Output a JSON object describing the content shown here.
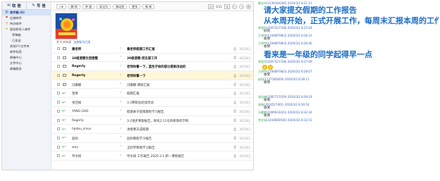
{
  "sidebar": {
    "receive_label": "收 信",
    "compose_label": "写 信",
    "items": [
      {
        "label": "收件箱 (6)",
        "icon": "inbox-icon",
        "active": true,
        "sub": false
      },
      {
        "label": "红旗邮件",
        "icon": "flag-icon",
        "active": false,
        "sub": false
      },
      {
        "label": "待办邮件",
        "icon": "clock-icon",
        "active": false,
        "sub": false
      },
      {
        "label": "星标联系人邮件",
        "icon": "star-icon",
        "active": false,
        "sub": false
      },
      {
        "label": "草稿箱",
        "icon": "",
        "active": false,
        "sub": true
      },
      {
        "label": "已发送",
        "icon": "",
        "active": false,
        "sub": true
      },
      {
        "label": "其他2个文件夹",
        "icon": "",
        "active": false,
        "sub": false
      },
      {
        "label": "邮件标签",
        "icon": "",
        "active": false,
        "sub": false
      },
      {
        "label": "邮箱中心",
        "icon": "",
        "active": false,
        "sub": false
      },
      {
        "label": "文件中心",
        "icon": "",
        "active": false,
        "sub": false
      },
      {
        "label": "邮箱服务",
        "icon": "",
        "active": false,
        "sub": false
      }
    ]
  },
  "toolbar": {
    "buttons": [
      "删 除",
      "举 报",
      "标记为",
      "移动到",
      "更多",
      "刷 新"
    ],
    "page": "1/11"
  },
  "summary": {
    "count": "共 4 封未读",
    "mark_all": "全部标为已读"
  },
  "emails": [
    {
      "from": "秦老师",
      "subject": "秦老师假期工作汇报",
      "time": "3月10日",
      "unread": true,
      "replied": false,
      "attach": true,
      "selected": false
    },
    {
      "from": "20级酒管生团委整",
      "subject": "20级酒管-团支部工作",
      "time": "3月10日",
      "unread": true,
      "replied": false,
      "attach": true,
      "selected": false
    },
    {
      "from": "Rogerly",
      "subject": "老师你看一下，蓝色字体的部分是新改动的",
      "time": "3月10日",
      "unread": true,
      "replied": false,
      "attach": true,
      "selected": false
    },
    {
      "from": "Rogerly",
      "subject": "老师你看一下",
      "time": "3月10日",
      "unread": true,
      "replied": false,
      "attach": true,
      "selected": true
    },
    {
      "from": "冯娜娜",
      "subject": "冯娜娜-寒假汇报",
      "time": "3月10日",
      "unread": false,
      "replied": false,
      "attach": true,
      "selected": false
    },
    {
      "from": "邹青",
      "subject": "假期汇报",
      "time": "3月10日",
      "unread": false,
      "replied": true,
      "attach": true,
      "selected": false
    },
    {
      "from": "张佳楠",
      "subject": "3.2寒假总结加活动",
      "time": "3月10日",
      "unread": false,
      "replied": true,
      "attach": true,
      "selected": false
    },
    {
      "from": "YANG GAO",
      "subject": "假期关于疫情期的学习报告",
      "time": "3月10日",
      "unread": false,
      "replied": true,
      "attach": true,
      "selected": false
    },
    {
      "from": "Rogerly",
      "subject": "3-2逐步寒假报告，附有2.11号的修改的学和",
      "time": "3月10日",
      "unread": false,
      "replied": true,
      "attach": true,
      "selected": false
    },
    {
      "from": "hpdou_sinus",
      "subject": "承接寒天成假期",
      "time": "3月10日",
      "unread": false,
      "replied": true,
      "attach": true,
      "selected": false
    },
    {
      "from": "赵阳",
      "subject": "赵阳寒假学习报告",
      "time": "3月10日",
      "unread": false,
      "replied": true,
      "attach": true,
      "selected": false
    },
    {
      "from": "wxy",
      "subject": "王欣宇寒假学习报告",
      "time": "3月10日",
      "unread": false,
      "replied": true,
      "attach": true,
      "selected": false
    },
    {
      "from": "夸文如",
      "subject": "夸文如 工作报告 2020.3.1.新---寒假报告",
      "time": "3月10日",
      "unread": false,
      "replied": true,
      "attach": true,
      "selected": false
    }
  ],
  "chat": [
    {
      "type": "msg",
      "name": "曾文玲",
      "id": "(3136184180)",
      "date": "2020/3/2 8:21:12"
    },
    {
      "type": "big",
      "text": "请大家提交假期的工作报告"
    },
    {
      "type": "big",
      "text": "从本周开始，正式开展工作，每周末汇报本周的工作"
    },
    {
      "type": "msg",
      "name": "李国华",
      "id": "(2007321748)",
      "date": "2020/3/2 8:25:44"
    },
    {
      "type": "text",
      "text": "好的"
    },
    {
      "type": "msg",
      "name": "王明宇",
      "id": "(1194897863)",
      "date": "2020/3/2 8:26:10"
    },
    {
      "type": "text",
      "text": "收到"
    },
    {
      "type": "msg",
      "name": "王明宇",
      "id": "(1194897863)",
      "date": "2020/3/2 8:26:40"
    },
    {
      "type": "text",
      "text": "收到"
    },
    {
      "type": "big",
      "text": "看来是一年级的同学起得早一点"
    },
    {
      "type": "msg",
      "name": "李国华",
      "id": "(2007321748)",
      "date": "2020/3/2 8:27:09"
    },
    {
      "type": "emoji",
      "count": 2
    },
    {
      "type": "msg",
      "name": "王明宇",
      "id": "(1194897863)",
      "date": "2020/3/2 8:28:07"
    },
    {
      "type": "text",
      "text": "收到"
    },
    {
      "type": "msg",
      "name": "赵阳",
      "id": "(1137185829)",
      "date": "2020/3/2 8:28:11"
    },
    {
      "type": "text",
      "text": "收到"
    },
    {
      "type": "gap"
    },
    {
      "type": "msg",
      "name": "张佳楠",
      "id": "(2081717029)",
      "date": "2020/3/2 8:29:19"
    },
    {
      "type": "text",
      "text": "收到"
    },
    {
      "type": "msg",
      "name": "邹青",
      "id": "(2014527401)",
      "date": "2020/3/2 8:30:54"
    },
    {
      "type": "text",
      "text": "收到"
    },
    {
      "type": "msg",
      "name": "冯娜娜",
      "id": "(1006933243)",
      "date": "2020/3/2 8:32:34"
    },
    {
      "type": "text",
      "text": "收到"
    },
    {
      "type": "msg",
      "name": "夸文如",
      "id": "(3244685936)",
      "date": "2020/3/2 8:32:51"
    }
  ],
  "colors": {
    "accent": "#1f6fc4",
    "sender_name": "#2fa84f",
    "timestamp": "#3e61b5"
  }
}
